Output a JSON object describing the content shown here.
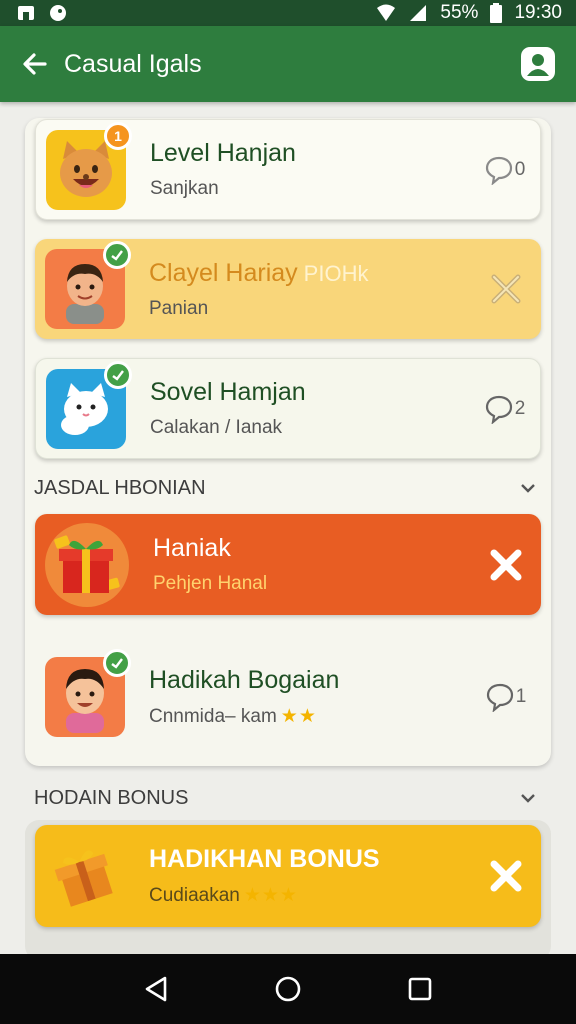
{
  "status_bar": {
    "battery": "55%",
    "time": "19:30"
  },
  "app_bar": {
    "title": "Casual Igals"
  },
  "cards": [
    {
      "name": "Level Hanjan",
      "sub": "Sanjkan",
      "action_count": "0",
      "badge": "1"
    },
    {
      "name": "Clayel Hariay",
      "name_extra": "PIOHk",
      "sub": "Panian"
    },
    {
      "name": "Sovel Hamjan",
      "sub": "Calakan / Ianak",
      "action_count": "2"
    }
  ],
  "section1": {
    "title": "JASDAL HBONIAN"
  },
  "card4": {
    "name": "Haniak",
    "sub": "Pehjen Hanal"
  },
  "card5": {
    "name": "Hadikah Bogaian",
    "sub": "Cnnmida– kam",
    "stars": "★★",
    "action_count": "1"
  },
  "section2": {
    "title": "HODAIN BONUS"
  },
  "card6": {
    "name": "HADIKHAN BONUS",
    "sub": "Cudiaakan",
    "stars": "★★★"
  },
  "colors": {
    "appbar": "#2e7d3e",
    "accent_orange": "#e85d23",
    "accent_yellow": "#f6bc1a",
    "accent_light_yellow": "#f9d67a",
    "badge_green": "#43a047",
    "badge_orange": "#f5941e"
  }
}
